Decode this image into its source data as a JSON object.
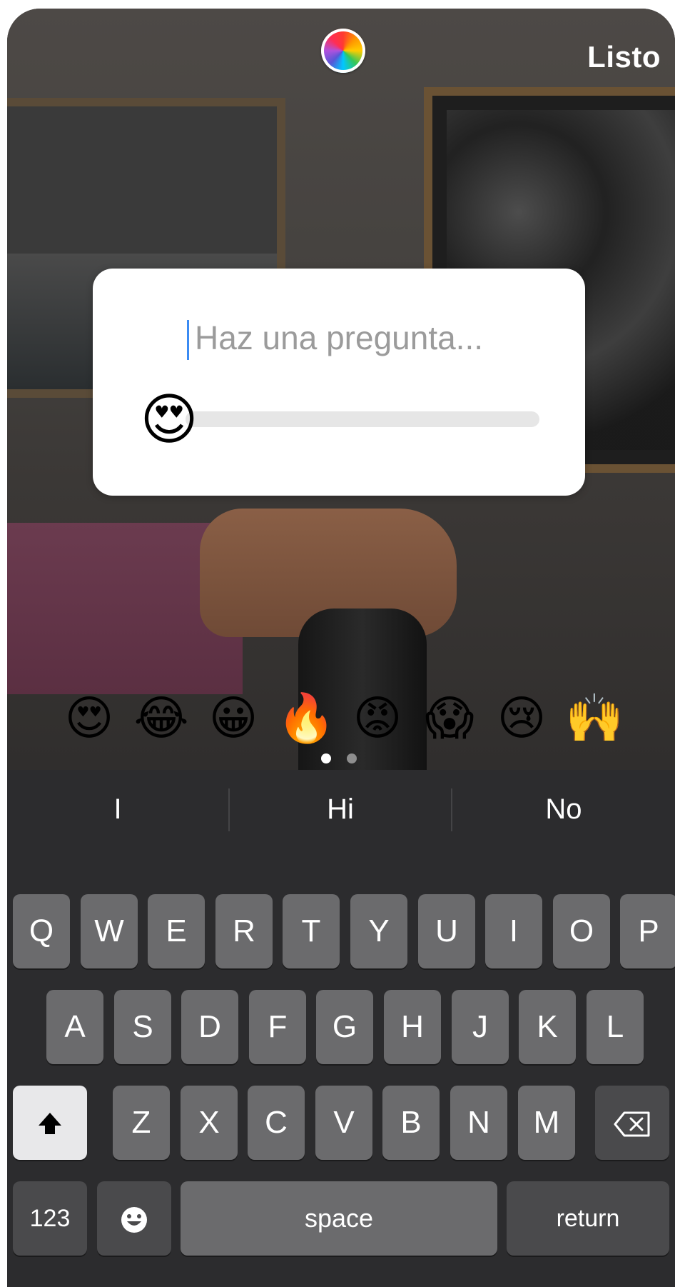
{
  "header": {
    "done_label": "Listo",
    "color_wheel_icon": "color-wheel-icon"
  },
  "slider_sticker": {
    "question_placeholder": "Haz una pregunta...",
    "thumb_emoji": "😍"
  },
  "emoji_options": [
    "😍",
    "😂",
    "😀",
    "🔥",
    "😡",
    "😱",
    "😢",
    "🙌"
  ],
  "emoji_pages": {
    "count": 2,
    "active_index": 0
  },
  "keyboard": {
    "suggestions": [
      "I",
      "Hi",
      "No"
    ],
    "row1": [
      "Q",
      "W",
      "E",
      "R",
      "T",
      "Y",
      "U",
      "I",
      "O",
      "P"
    ],
    "row2": [
      "A",
      "S",
      "D",
      "F",
      "G",
      "H",
      "J",
      "K",
      "L"
    ],
    "row3": [
      "Z",
      "X",
      "C",
      "V",
      "B",
      "N",
      "M"
    ],
    "shift_icon": "shift-arrow-icon",
    "delete_icon": "delete-backspace-icon",
    "numbers_label": "123",
    "emoji_icon": "emoji-face-icon",
    "space_label": "space",
    "return_label": "return"
  },
  "colors": {
    "caret": "#3b8bf3",
    "keyboard_bg": "#2c2c2e",
    "key_bg": "#6b6b6d",
    "shift_key_bg": "#e8e8ea"
  }
}
